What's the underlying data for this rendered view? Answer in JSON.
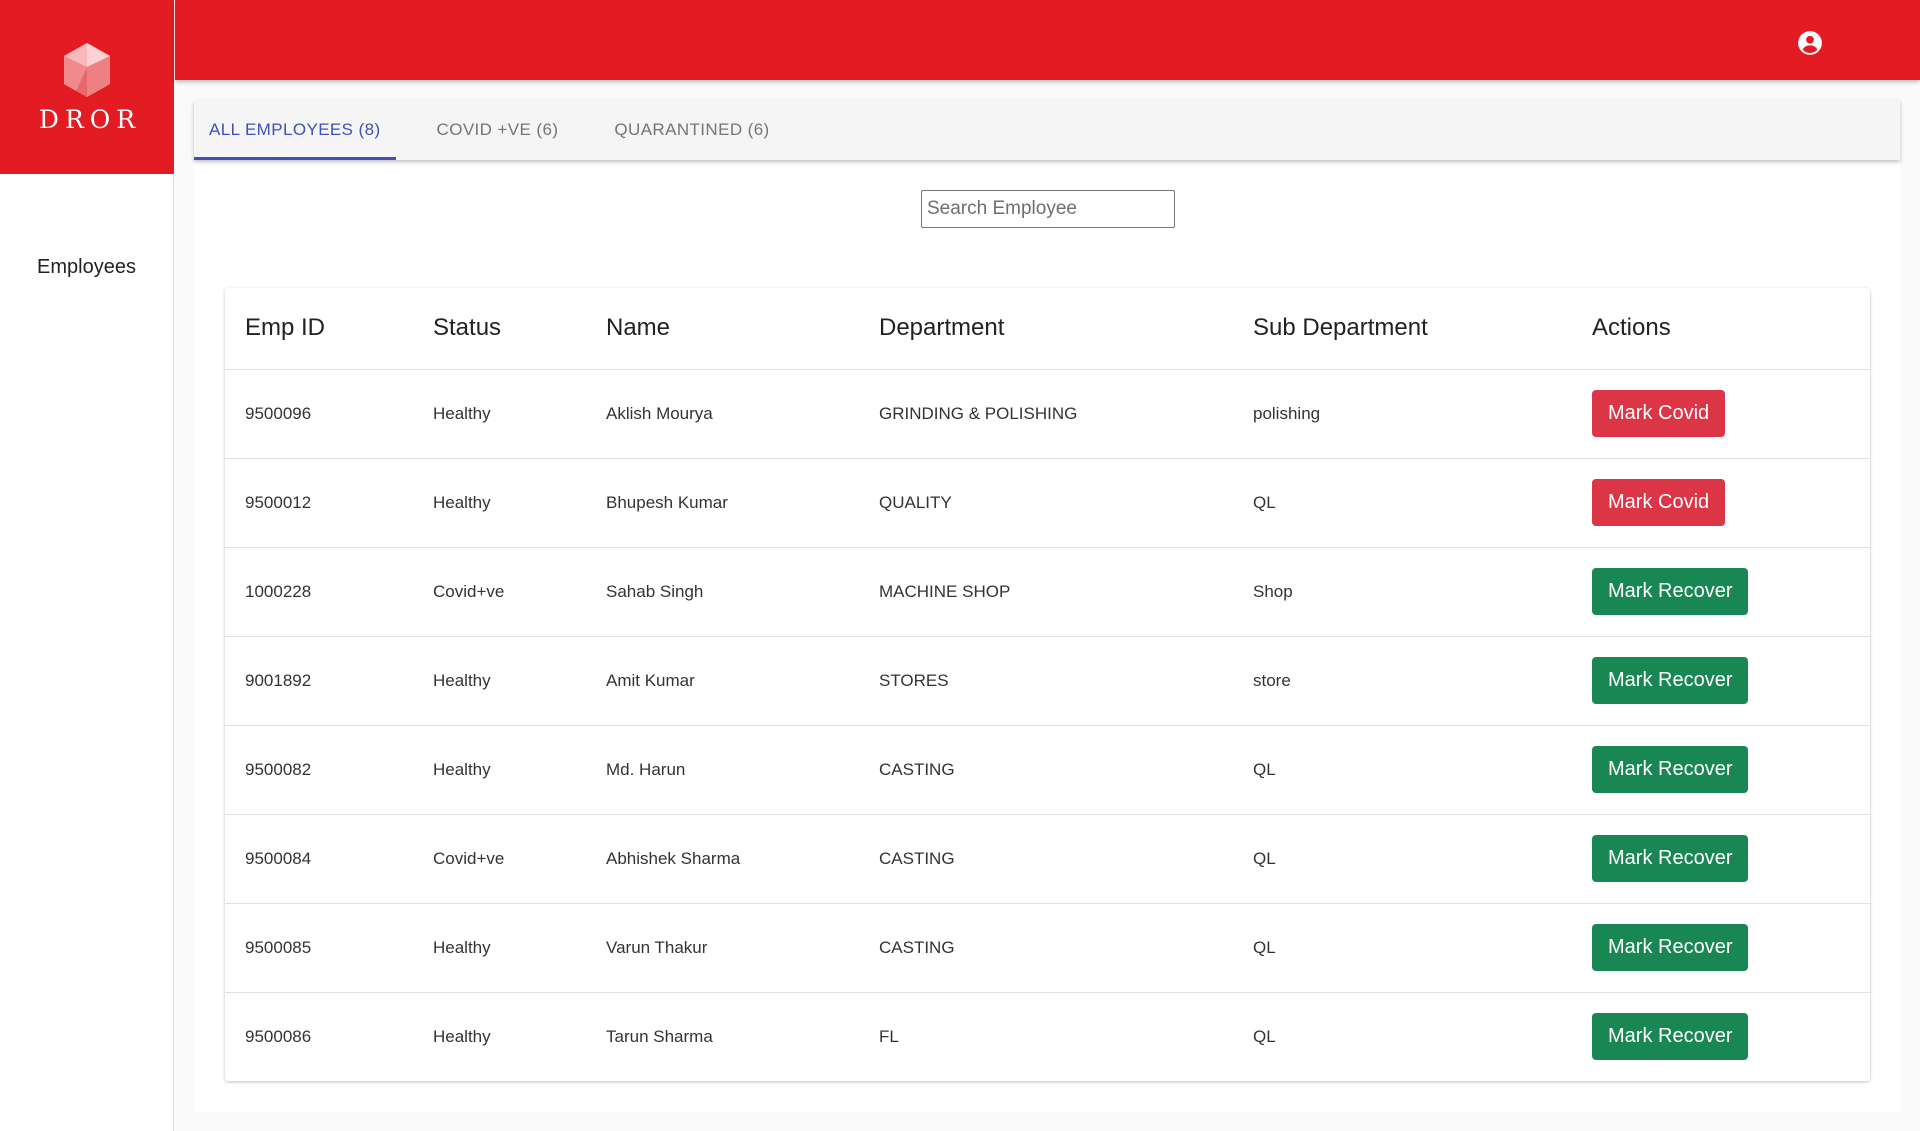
{
  "brand": {
    "logo_text": "DROR",
    "accent_color": "#e31b23"
  },
  "sidebar": {
    "items": [
      {
        "label": "Employees"
      }
    ]
  },
  "header": {
    "account_icon": "account-circle-icon"
  },
  "tabs": [
    {
      "label": "ALL EMPLOYEES (8)",
      "active": true
    },
    {
      "label": "COVID +VE (6)",
      "active": false
    },
    {
      "label": "QUARANTINED (6)",
      "active": false
    }
  ],
  "search": {
    "placeholder": "Search Employee",
    "value": ""
  },
  "table": {
    "headers": [
      "Emp ID",
      "Status",
      "Name",
      "Department",
      "Sub Department",
      "Actions"
    ],
    "rows": [
      {
        "emp_id": "9500096",
        "status": "Healthy",
        "name": "Aklish Mourya",
        "department": "GRINDING & POLISHING",
        "sub_department": "polishing",
        "action": "Mark Covid",
        "action_type": "covid"
      },
      {
        "emp_id": "9500012",
        "status": "Healthy",
        "name": "Bhupesh Kumar",
        "department": "QUALITY",
        "sub_department": "QL",
        "action": "Mark Covid",
        "action_type": "covid"
      },
      {
        "emp_id": "1000228",
        "status": "Covid+ve",
        "name": "Sahab Singh",
        "department": "MACHINE SHOP",
        "sub_department": "Shop",
        "action": "Mark Recover",
        "action_type": "recover"
      },
      {
        "emp_id": "9001892",
        "status": "Healthy",
        "name": "Amit Kumar",
        "department": "STORES",
        "sub_department": "store",
        "action": "Mark Recover",
        "action_type": "recover"
      },
      {
        "emp_id": "9500082",
        "status": "Healthy",
        "name": "Md. Harun",
        "department": "CASTING",
        "sub_department": "QL",
        "action": "Mark Recover",
        "action_type": "recover"
      },
      {
        "emp_id": "9500084",
        "status": "Covid+ve",
        "name": "Abhishek Sharma",
        "department": "CASTING",
        "sub_department": "QL",
        "action": "Mark Recover",
        "action_type": "recover"
      },
      {
        "emp_id": "9500085",
        "status": "Healthy",
        "name": "Varun Thakur",
        "department": "CASTING",
        "sub_department": "QL",
        "action": "Mark Recover",
        "action_type": "recover"
      },
      {
        "emp_id": "9500086",
        "status": "Healthy",
        "name": "Tarun Sharma",
        "department": "FL",
        "sub_department": "QL",
        "action": "Mark Recover",
        "action_type": "recover"
      }
    ]
  },
  "colors": {
    "tab_active": "#3f51b5",
    "mark_covid": "#dc3545",
    "mark_recover": "#198754"
  }
}
